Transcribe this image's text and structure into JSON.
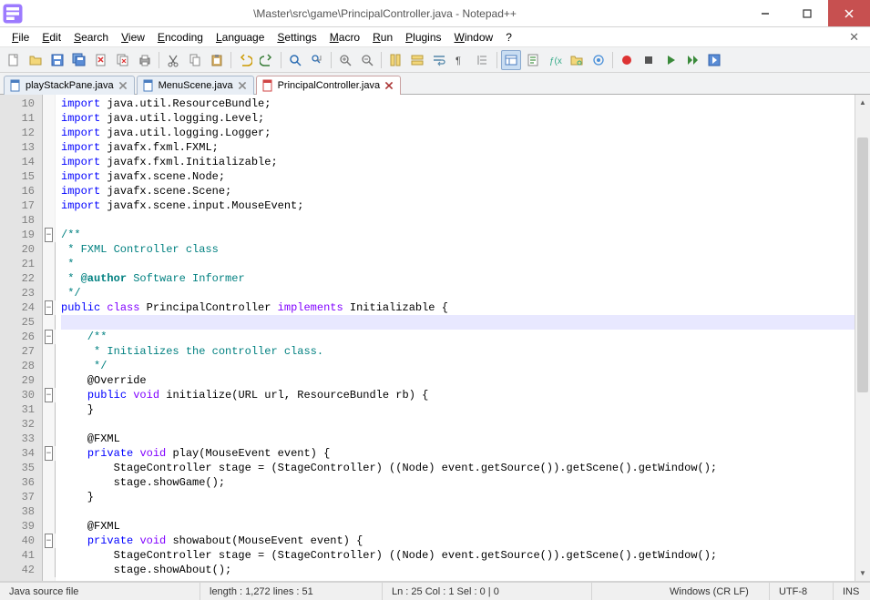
{
  "window": {
    "title_left": "\\Master\\src\\game\\PrincipalController.java - Notepad++"
  },
  "menus": [
    "File",
    "Edit",
    "Search",
    "View",
    "Encoding",
    "Language",
    "Settings",
    "Macro",
    "Run",
    "Plugins",
    "Window",
    "?"
  ],
  "tabs": [
    {
      "label": "playStackPane.java",
      "active": false,
      "dirty": false
    },
    {
      "label": "MenuScene.java",
      "active": false,
      "dirty": false
    },
    {
      "label": "PrincipalController.java",
      "active": true,
      "dirty": true
    }
  ],
  "status": {
    "filetype": "Java source file",
    "length_label": "length : 1,272    lines : 51",
    "pos_label": "Ln : 25    Col : 1    Sel : 0 | 0",
    "eol": "Windows (CR LF)",
    "encoding": "UTF-8",
    "mode": "INS"
  },
  "first_line": 10,
  "code": [
    {
      "t": "import",
      "r": " java.util.ResourceBundle;"
    },
    {
      "t": "import",
      "r": " java.util.logging.Level;"
    },
    {
      "t": "import",
      "r": " java.util.logging.Logger;"
    },
    {
      "t": "import",
      "r": " javafx.fxml.FXML;"
    },
    {
      "t": "import",
      "r": " javafx.fxml.Initializable;"
    },
    {
      "t": "import",
      "r": " javafx.scene.Node;"
    },
    {
      "t": "import",
      "r": " javafx.scene.Scene;"
    },
    {
      "t": "import",
      "r": " javafx.scene.input.MouseEvent;"
    },
    {
      "blank": true
    },
    {
      "cmt": "/**",
      "fold": "box"
    },
    {
      "cmt": " * FXML Controller class",
      "foldline": true
    },
    {
      "cmt": " *",
      "foldline": true
    },
    {
      "cmt_author": " * @author",
      "cmt_after": " Software Informer",
      "foldline": true
    },
    {
      "cmt": " */",
      "foldline": true
    },
    {
      "class_decl": true,
      "fold": "box"
    },
    {
      "blank": true,
      "current": true,
      "foldline": true
    },
    {
      "cmt": "    /**",
      "fold": "box"
    },
    {
      "cmt": "     * Initializes the controller class.",
      "foldline": true
    },
    {
      "cmt": "     */",
      "foldline": true
    },
    {
      "override": true,
      "foldline": true
    },
    {
      "method_init": true,
      "fold": "box"
    },
    {
      "raw": "    }",
      "foldline": true
    },
    {
      "blank": true,
      "foldline": true
    },
    {
      "fxml": true,
      "foldline": true
    },
    {
      "method_play": true,
      "fold": "box"
    },
    {
      "stage_line": true,
      "foldline": true
    },
    {
      "raw": "        stage.showGame();",
      "foldline": true
    },
    {
      "raw": "    }",
      "foldline": true
    },
    {
      "blank": true,
      "foldline": true
    },
    {
      "fxml": true,
      "foldline": true
    },
    {
      "method_showabout": true,
      "fold": "box"
    },
    {
      "stage_line": true,
      "foldline": true
    },
    {
      "show_about": true,
      "foldline": true
    }
  ],
  "tokens": {
    "import": "import",
    "public": "public",
    "class": "class",
    "implements": "implements",
    "void": "void",
    "private": "private",
    "class_name": "PrincipalController",
    "iface": "Initializable",
    "override": "@Override",
    "fxml_ann": "@FXML",
    "init_sig": " initialize(URL url, ResourceBundle rb) {",
    "play_sig": " play(MouseEvent event) {",
    "showabout_sig": " showabout(MouseEvent event) {",
    "stage_line": "        StageController stage = (StageController) ((Node) event.getSource()).getScene().getWindow();",
    "show_about": "        stage.showAbout();"
  }
}
